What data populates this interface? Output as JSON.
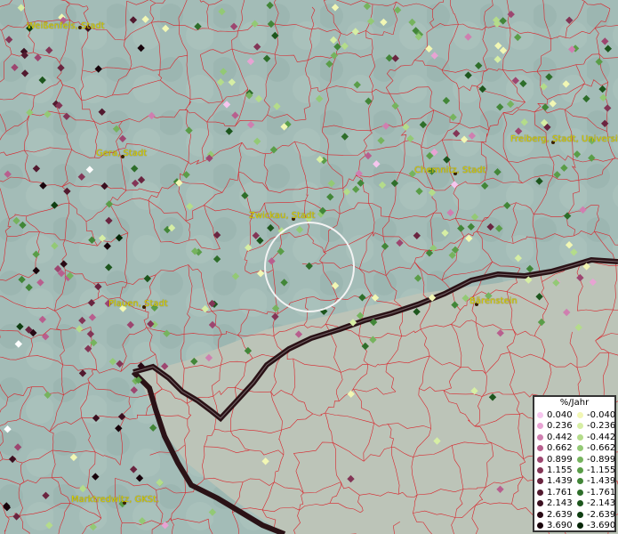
{
  "map": {
    "cities": [
      {
        "label": "Weißenfels, Stadt"
      },
      {
        "label": "Gera, Stadt"
      },
      {
        "label": "Chemnitz, Stadt"
      },
      {
        "label": "Freiberg, Stadt, Universität"
      },
      {
        "label": "Zwickau, Stadt"
      },
      {
        "label": "Plauen, Stadt"
      },
      {
        "label": "Bärenstein"
      },
      {
        "label": "Marktredwitz, GKSt."
      }
    ]
  },
  "legend": {
    "title": "%/Jahr",
    "positive": [
      {
        "value": "0.040",
        "color": "#f6c6ee"
      },
      {
        "value": "0.236",
        "color": "#e7a3d3"
      },
      {
        "value": "0.442",
        "color": "#cf7fb0"
      },
      {
        "value": "0.662",
        "color": "#b85f8e"
      },
      {
        "value": "0.899",
        "color": "#9d4670"
      },
      {
        "value": "1.155",
        "color": "#833556"
      },
      {
        "value": "1.439",
        "color": "#6a2540"
      },
      {
        "value": "1.761",
        "color": "#521a2f"
      },
      {
        "value": "2.143",
        "color": "#3b1020"
      },
      {
        "value": "2.639",
        "color": "#280914"
      },
      {
        "value": "3.690",
        "color": "#18040b"
      }
    ],
    "negative": [
      {
        "value": "-0.040",
        "color": "#f2f7b4"
      },
      {
        "value": "-0.236",
        "color": "#d6eea4"
      },
      {
        "value": "-0.442",
        "color": "#b4dc8a"
      },
      {
        "value": "-0.662",
        "color": "#93c975"
      },
      {
        "value": "-0.899",
        "color": "#76b35e"
      },
      {
        "value": "-1.155",
        "color": "#5a9d48"
      },
      {
        "value": "-1.439",
        "color": "#428638"
      },
      {
        "value": "-1.761",
        "color": "#2e6e2a"
      },
      {
        "value": "-2.143",
        "color": "#1d561d"
      },
      {
        "value": "-2.639",
        "color": "#0f3e12"
      },
      {
        "value": "-3.690",
        "color": "#062608"
      }
    ]
  }
}
